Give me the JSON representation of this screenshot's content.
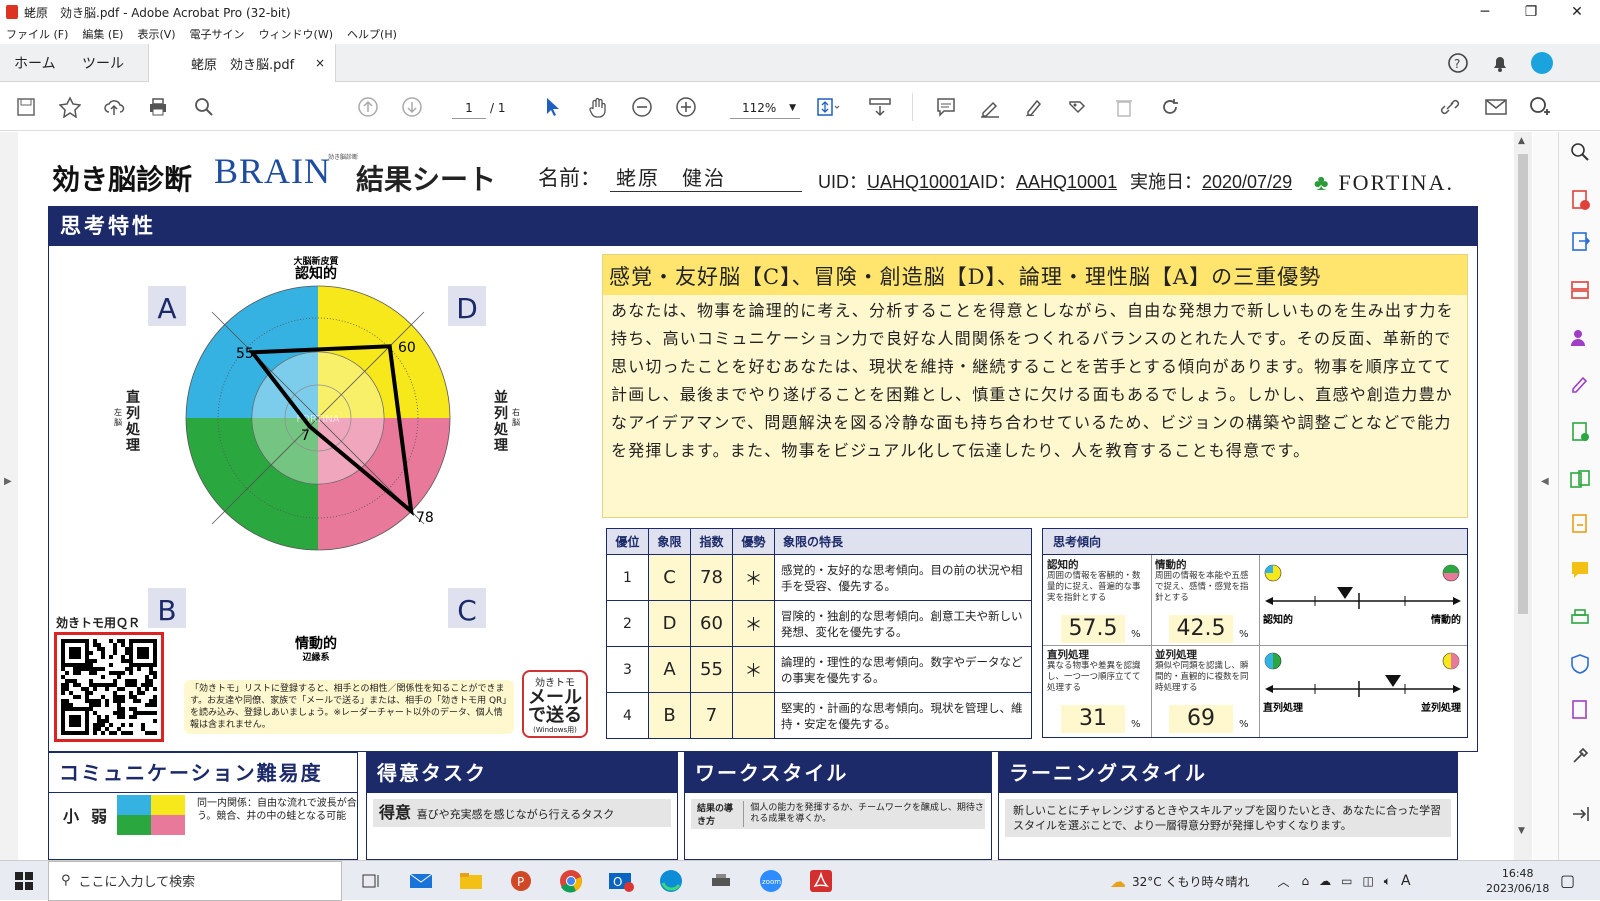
{
  "window": {
    "title": "蛯原　効き脳.pdf - Adobe Acrobat Pro (32-bit)"
  },
  "menu": [
    "ファイル (F)",
    "編集 (E)",
    "表示(V)",
    "電子サイン",
    "ウィンドウ(W)",
    "ヘルプ(H)"
  ],
  "tabs": {
    "home": "ホーム",
    "tools": "ツール",
    "doc": "蛯原　効き脳.pdf",
    "close": "×"
  },
  "toolbar": {
    "page_current": "1",
    "page_total": "/ 1",
    "zoom": "112%"
  },
  "sheet": {
    "title_left": "効き脳診断",
    "brand": "BRAIN",
    "brand_small": "効き脳診断",
    "title_right": "結果シート",
    "name_label": "名前：",
    "name_value": "蛯原　健治",
    "uid_label": "UID：",
    "uid_value": "UAHQ10001",
    "aid_label": "AID：",
    "aid_value": "AAHQ10001",
    "date_label": "実施日：",
    "date_value": "2020/07/29",
    "logo": "FORTINA."
  },
  "section": {
    "title": "思考特性"
  },
  "chart": {
    "top_label_small": "大脳新皮質",
    "top_label": "認知的",
    "bottom_label": "情動的",
    "bottom_label_small": "辺縁系",
    "left_label": "直列処理",
    "left_small": "左脳",
    "right_label": "並列処理",
    "right_small": "右脳",
    "quad_a": "A",
    "quad_b": "B",
    "quad_c": "C",
    "quad_d": "D",
    "val_a": "55",
    "val_b": "7",
    "val_c": "78",
    "val_d": "60",
    "watermark": "FORTINA",
    "colors": {
      "A": "#35b2e1",
      "B": "#2ba740",
      "C": "#e8799b",
      "D": "#f6e81a"
    }
  },
  "chart_data": {
    "type": "radar",
    "categories": [
      "A",
      "D",
      "C",
      "B"
    ],
    "values": [
      55,
      60,
      78,
      7
    ]
  },
  "result": {
    "heading": "感覚・友好脳【C】、冒険・創造脳【D】、論理・理性脳【A】の三重優勢",
    "body": "あなたは、物事を論理的に考え、分析することを得意としながら、自由な発想力で新しいものを生み出す力を持ち、高いコミュニケーション力で良好な人間関係をつくれるバランスのとれた人です。その反面、革新的で思い切ったことを好むあなたは、現状を維持・継続することを苦手とする傾向があります。物事を順序立てて計画し、最後までやり遂げることを困難とし、慎重さに欠ける面もあるでしょう。しかし、直感や創造力豊かなアイデアマンで、問題解決を図る冷静な面も持ち合わせているため、ビジョンの構築や調整ごとなどで能力を発揮します。また、物事をビジュアル化して伝達したり、人を教育することも得意です。"
  },
  "rank_table": {
    "headers": [
      "優位",
      "象限",
      "指数",
      "優勢",
      "象限の特長"
    ],
    "rows": [
      {
        "rank": "1",
        "quad": "C",
        "index": "78",
        "dom": "＊",
        "desc": "感覚的・友好的な思考傾向。目の前の状況や相手を受容、優先する。"
      },
      {
        "rank": "2",
        "quad": "D",
        "index": "60",
        "dom": "＊",
        "desc": "冒険的・独創的な思考傾向。創意工夫や新しい発想、変化を優先する。"
      },
      {
        "rank": "3",
        "quad": "A",
        "index": "55",
        "dom": "＊",
        "desc": "論理的・理性的な思考傾向。数字やデータなどの事実を優先する。"
      },
      {
        "rank": "4",
        "quad": "B",
        "index": "7",
        "dom": "",
        "desc": "堅実的・計画的な思考傾向。現状を管理し、維持・安定を優先する。"
      }
    ]
  },
  "tendency": {
    "header": "思考傾向",
    "cog_label": "認知的",
    "cog_desc": "周囲の情報を客観的・数量的に捉え、普遍的な事実を指針とする",
    "cog_value": "57.5",
    "emo_label": "情動的",
    "emo_desc": "周囲の情報を本能や五感で捉え、感情・感覚を指針とする",
    "emo_value": "42.5",
    "ser_label": "直列処理",
    "ser_desc": "異なる物事や差異を認識し、一つ一つ順序立てて処理する",
    "ser_value": "31",
    "par_label": "並列処理",
    "par_desc": "類似や同類を認識し、瞬間的・直観的に複数を同時処理する",
    "par_value": "69",
    "pct": "%",
    "scale1_left": "認知的",
    "scale1_right": "情動的",
    "scale2_left": "直列処理",
    "scale2_right": "並列処理"
  },
  "qr": {
    "label": "効きトモ用ＱＲ",
    "note": "「効きトモ」リストに登録すると、相手との相性／関係性を知ることができます。お友達や同僚、家族で「メールで送る」または、相手の「効きトモ用 QR」を読み込み、登録しあいましょう。※レーダーチャート以外のデータ、個人情報は含まれません。",
    "mail_top": "効きトモ",
    "mail_big1": "メール",
    "mail_big2": "で送る",
    "mail_bottom": "(Windows用)"
  },
  "bottom": {
    "comm_title": "コミュニケーション難易度",
    "comm_level1": "小",
    "comm_level2": "弱",
    "comm_note": "同一内関係：自由な流れで波長が合う。競合、井の中の蛙となる可能",
    "task_title": "得意タスク",
    "task_row_label": "得意",
    "task_row_desc": "喜びや充実感を感じながら行えるタスク",
    "work_title": "ワークスタイル",
    "work_row_label": "結果の導き方",
    "work_row_desc": "個人の能力を発揮するか、チームワークを醸成し、期待される成果を導くか。",
    "learn_title": "ラーニングスタイル",
    "learn_desc": "新しいことにチャレンジするときやスキルアップを図りたいとき、あなたに合った学習スタイルを選ぶことで、より一層得意分野が発揮しやすくなります。"
  },
  "taskbar": {
    "search": "ここに入力して検索",
    "weather": "32°C くもり時々晴れ",
    "time": "16:48",
    "date": "2023/06/18"
  }
}
